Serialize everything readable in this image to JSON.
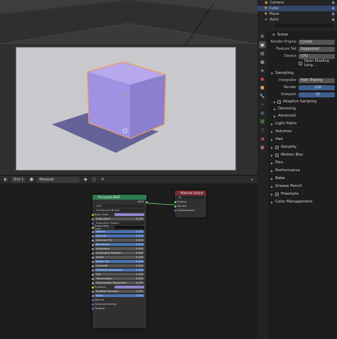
{
  "outliner": {
    "items": [
      {
        "label": "Camera",
        "selected": false
      },
      {
        "label": "Cube",
        "selected": true
      },
      {
        "label": "Plane",
        "selected": false
      },
      {
        "label": "Point",
        "selected": false
      }
    ]
  },
  "viewport_header": {
    "slot": "Slot 1",
    "material": "Material"
  },
  "properties": {
    "scene_label": "Scene",
    "render_engine_label": "Render Engine",
    "render_engine": "Cycles",
    "feature_set_label": "Feature Set",
    "feature_set": "Supported",
    "device_label": "Device",
    "device": "CPU",
    "open_shading_label": "Open Shading Lang...",
    "sampling_label": "Sampling",
    "integrator_label": "Integrator",
    "integrator": "Path Tracing",
    "render_label": "Render",
    "render_value": "128",
    "viewport_label": "Viewport",
    "viewport_value": "32",
    "adaptive_sampling": "Adaptive Sampling",
    "denoising": "Denoising",
    "advanced": "Advanced",
    "sections": [
      "Light Paths",
      "Volumes",
      "Hair",
      "Simplify",
      "Motion Blur",
      "Film",
      "Performance",
      "Bake",
      "Grease Pencil",
      "Freestyle",
      "Color Management"
    ]
  },
  "nodes": {
    "principled": {
      "title": "Principled BSDF",
      "output": "BSDF",
      "distribution": "GGX",
      "subsurface_method": "Christensen-Burley",
      "rows": [
        {
          "label": "Base Color",
          "kind": "color",
          "color": "#8e82c9"
        },
        {
          "label": "Subsurface",
          "kind": "slider",
          "value": "0.000",
          "blue": false
        },
        {
          "label": "Subsurface Radius",
          "kind": "dd"
        },
        {
          "label": "Subsurface Color",
          "kind": "color",
          "color": "#111111"
        },
        {
          "label": "Metallic",
          "kind": "slider",
          "value": "0.000",
          "blue": true
        },
        {
          "label": "Specular",
          "kind": "slider",
          "value": "0.500",
          "blue": true
        },
        {
          "label": "Specular Tint",
          "kind": "slider",
          "value": "0.000",
          "blue": false
        },
        {
          "label": "Roughness",
          "kind": "slider",
          "value": "0.500",
          "blue": true
        },
        {
          "label": "Anisotropic",
          "kind": "slider",
          "value": "0.000",
          "blue": false
        },
        {
          "label": "Anisotropic Rotation",
          "kind": "slider",
          "value": "0.000",
          "blue": false
        },
        {
          "label": "Sheen",
          "kind": "slider",
          "value": "0.000",
          "blue": false
        },
        {
          "label": "Sheen Tint",
          "kind": "slider",
          "value": "0.500",
          "blue": true
        },
        {
          "label": "Clearcoat",
          "kind": "slider",
          "value": "0.000",
          "blue": false
        },
        {
          "label": "Clearcoat Roughness",
          "kind": "slider",
          "value": "0.030",
          "blue": true
        },
        {
          "label": "IOR",
          "kind": "slider",
          "value": "1.450",
          "blue": false
        },
        {
          "label": "Transmission",
          "kind": "slider",
          "value": "0.000",
          "blue": false
        },
        {
          "label": "Transmission Roughness",
          "kind": "slider",
          "value": "0.000",
          "blue": false
        },
        {
          "label": "Emission",
          "kind": "color",
          "color": "#8e82c9"
        },
        {
          "label": "Emission Strength",
          "kind": "slider",
          "value": "1.000",
          "blue": false
        },
        {
          "label": "Alpha",
          "kind": "slider",
          "value": "1.000",
          "blue": true
        },
        {
          "label": "Normal",
          "kind": "plain"
        },
        {
          "label": "Clearcoat Normal",
          "kind": "plain"
        },
        {
          "label": "Tangent",
          "kind": "plain"
        }
      ]
    },
    "output": {
      "title": "Material Output",
      "target": "All",
      "inputs": [
        "Surface",
        "Volume",
        "Displacement"
      ]
    }
  }
}
